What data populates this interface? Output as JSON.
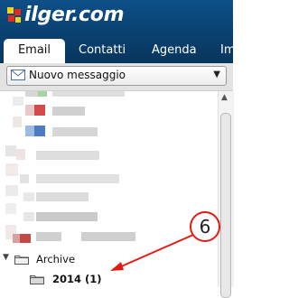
{
  "brand": {
    "name": "ilger.com"
  },
  "tabs": [
    {
      "label": "Email",
      "active": true
    },
    {
      "label": "Contatti",
      "active": false
    },
    {
      "label": "Agenda",
      "active": false
    },
    {
      "label": "Im",
      "active": false
    }
  ],
  "toolbar": {
    "new_message_label": "Nuovo messaggio"
  },
  "folders": {
    "archive_label": "Archive",
    "sub_label": "2014 (1)"
  },
  "annotation": {
    "number": "6"
  },
  "colors": {
    "header": "#0a3f6e",
    "annotation": "#e41b13"
  }
}
